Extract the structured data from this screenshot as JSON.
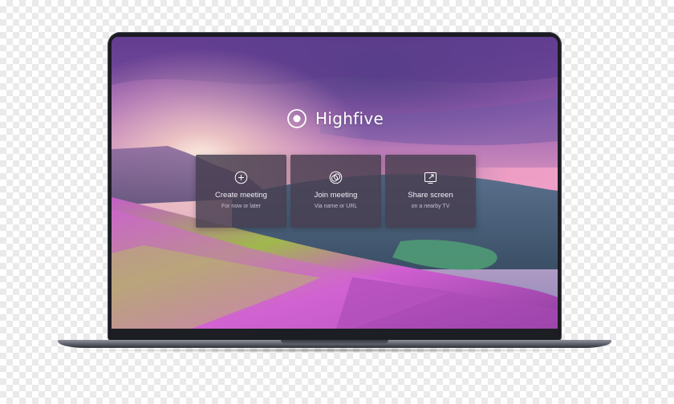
{
  "app": {
    "brand_name": "Highfive"
  },
  "actions": [
    {
      "title": "Create meeting",
      "subtitle": "For now or later",
      "icon": "plus-circle-icon"
    },
    {
      "title": "Join meeting",
      "subtitle": "Via name or URL",
      "icon": "overlapping-circles-icon"
    },
    {
      "title": "Share screen",
      "subtitle": "on a nearby TV",
      "icon": "cast-screen-icon"
    }
  ],
  "colors": {
    "card_background": "#483e50",
    "text": "#ffffff",
    "bezel": "#1b1c22"
  }
}
